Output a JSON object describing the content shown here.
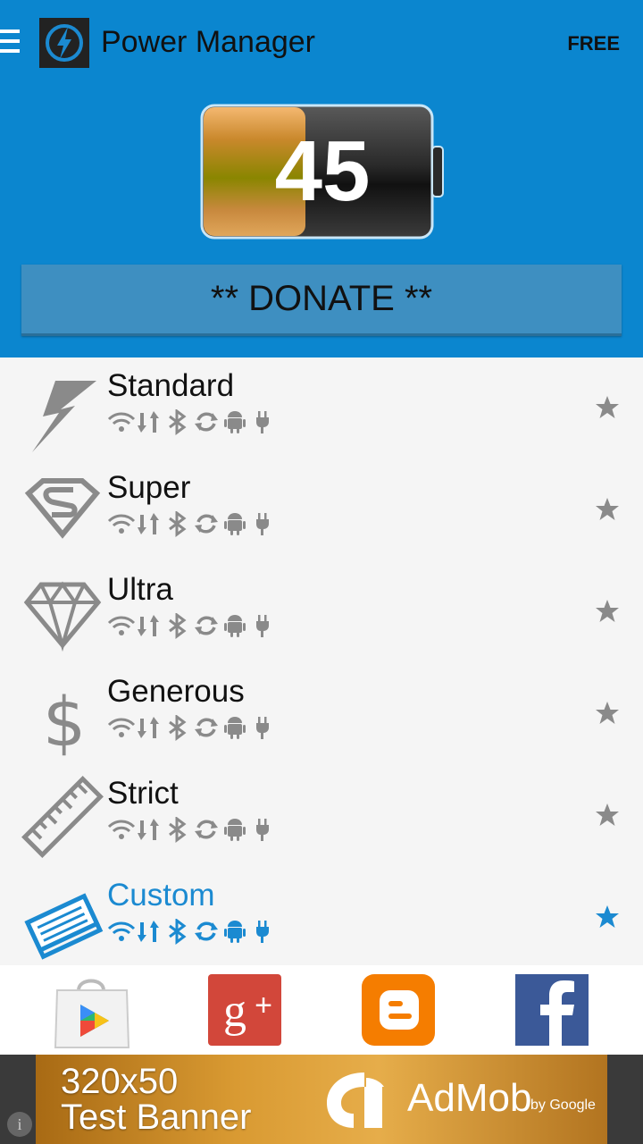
{
  "header": {
    "title": "Power Manager",
    "badge": "FREE",
    "background_color": "#0b86cf"
  },
  "battery": {
    "level_text": "45",
    "level_fraction": 0.45
  },
  "donate": {
    "label": "** DONATE **"
  },
  "profiles": [
    {
      "name": "Standard",
      "icon": "lightning-icon",
      "active": false
    },
    {
      "name": "Super",
      "icon": "superman-icon",
      "active": false
    },
    {
      "name": "Ultra",
      "icon": "diamond-icon",
      "active": false
    },
    {
      "name": "Generous",
      "icon": "dollar-icon",
      "active": false
    },
    {
      "name": "Strict",
      "icon": "ruler-icon",
      "active": false
    },
    {
      "name": "Custom",
      "icon": "notepad-icon",
      "active": true
    }
  ],
  "status_icons": [
    "wifi-icon",
    "data-icon",
    "bluetooth-icon",
    "sync-icon",
    "android-icon",
    "plug-icon"
  ],
  "social": [
    "play-store-icon",
    "google-plus-icon",
    "blogger-icon",
    "facebook-icon"
  ],
  "ad": {
    "line1": "320x50",
    "line2": "Test Banner",
    "brand": "AdMob",
    "brand_by": "by Google",
    "info": "i"
  },
  "colors": {
    "active": "#1b8ad1",
    "inactive": "#8a8a8a"
  }
}
